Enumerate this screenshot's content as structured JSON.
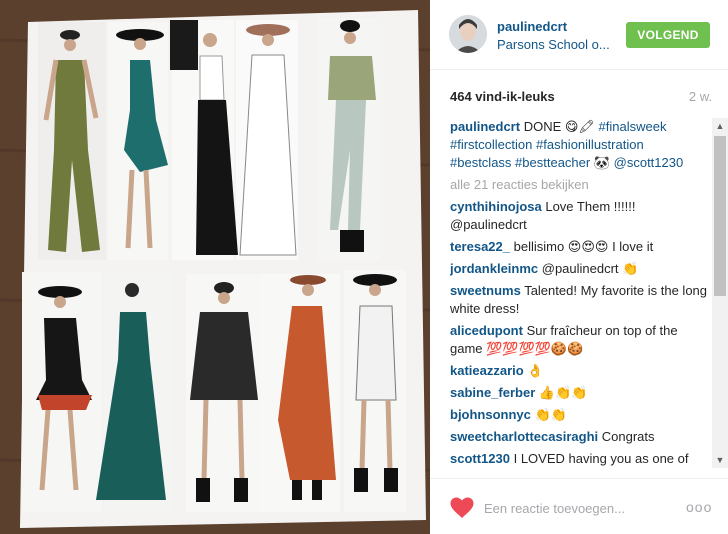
{
  "post": {
    "photo_label": "fashion-illustration-photo"
  },
  "header": {
    "username": "paulinedcrt",
    "location": "Parsons School o...",
    "follow_label": "VOLGEND"
  },
  "meta": {
    "likes": "464 vind-ik-leuks",
    "time": "2 w."
  },
  "caption": {
    "user": "paulinedcrt",
    "text_before": " DONE 😋🖍 ",
    "tags": [
      "#finalsweek",
      "#firstcollection",
      "#fashionillustration",
      "#bestclass",
      "#bestteacher"
    ],
    "emoji": " 🐼 ",
    "mention": "@scott1230"
  },
  "view_all": "alle 21 reacties bekijken",
  "comments": [
    {
      "user": "cynthihinojosa",
      "text": " Love Them !!!!!! @paulinedcrt"
    },
    {
      "user": "teresa22_",
      "text": " bellisimo 😍😍😍 I love it"
    },
    {
      "user": "jordankleinmc",
      "text": " @paulinedcrt 👏"
    },
    {
      "user": "sweetnums",
      "text": " Talented! My favorite is the long white dress!"
    },
    {
      "user": "alicedupont",
      "text": " Sur fraîcheur on top of the game 💯💯💯💯🍪🍪"
    },
    {
      "user": "katieazzario",
      "text": " 👌"
    },
    {
      "user": "sabine_ferber",
      "text": " 👍👏👏"
    },
    {
      "user": "bjohnsonnyc",
      "text": " 👏👏"
    },
    {
      "user": "sweetcharlottecasiraghi",
      "text": " Congrats"
    },
    {
      "user": "scott1230",
      "text": " I LOVED having you as one of"
    }
  ],
  "footer": {
    "reply_placeholder": "Een reactie toevoegen...",
    "more_label": "ooo"
  },
  "colors": {
    "link": "#125688",
    "follow": "#70c050",
    "heart": "#ed4956",
    "muted": "#a5a7aa"
  }
}
